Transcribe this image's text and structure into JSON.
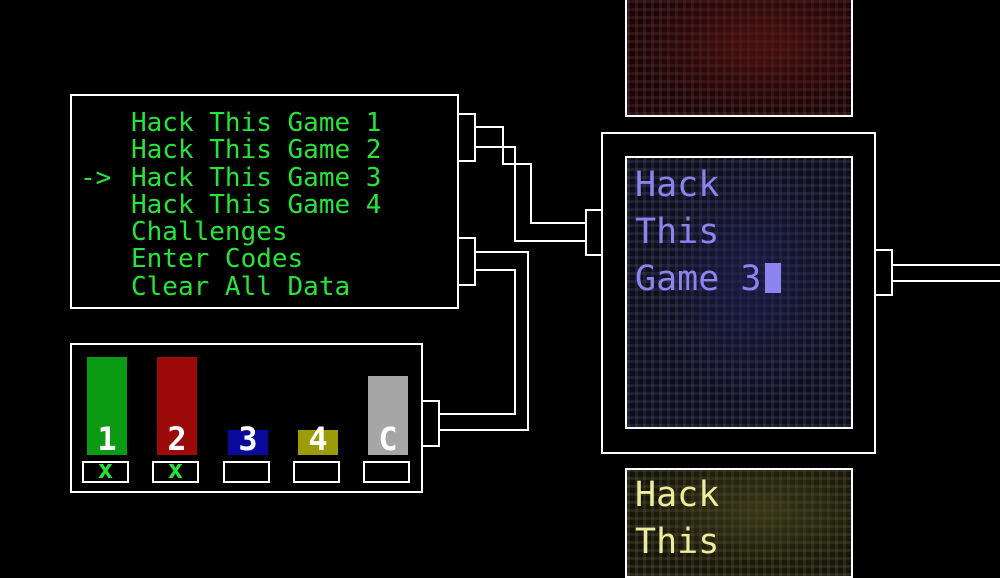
{
  "menu": {
    "items": [
      {
        "label": "Hack This Game 1",
        "cursor": ""
      },
      {
        "label": "Hack This Game 2",
        "cursor": ""
      },
      {
        "label": "Hack This Game 3",
        "cursor": "->"
      },
      {
        "label": "Hack This Game 4",
        "cursor": ""
      },
      {
        "label": "Challenges",
        "cursor": ""
      },
      {
        "label": "Enter Codes",
        "cursor": ""
      },
      {
        "label": "Clear All Data",
        "cursor": ""
      }
    ],
    "selected_index": 2,
    "text_color": "#27e33a"
  },
  "progress": {
    "games": [
      {
        "label": "1",
        "color": "#0a9a14",
        "level": 1.0,
        "completed": true
      },
      {
        "label": "2",
        "color": "#9c0a0a",
        "level": 1.0,
        "completed": true
      },
      {
        "label": "3",
        "color": "#0a0a9c",
        "level": 0.25,
        "completed": false
      },
      {
        "label": "4",
        "color": "#9c9c0a",
        "level": 0.25,
        "completed": false
      },
      {
        "label": "C",
        "color": "#a6a6a6",
        "level": 0.81,
        "completed": false
      }
    ],
    "check_symbol": "x"
  },
  "preview": {
    "main_title": "Hack\nThis\nGame 3",
    "bottom_title": "Hack\nThis",
    "main_text_color": "#8a84ee",
    "bottom_text_color": "#ecec9c"
  }
}
